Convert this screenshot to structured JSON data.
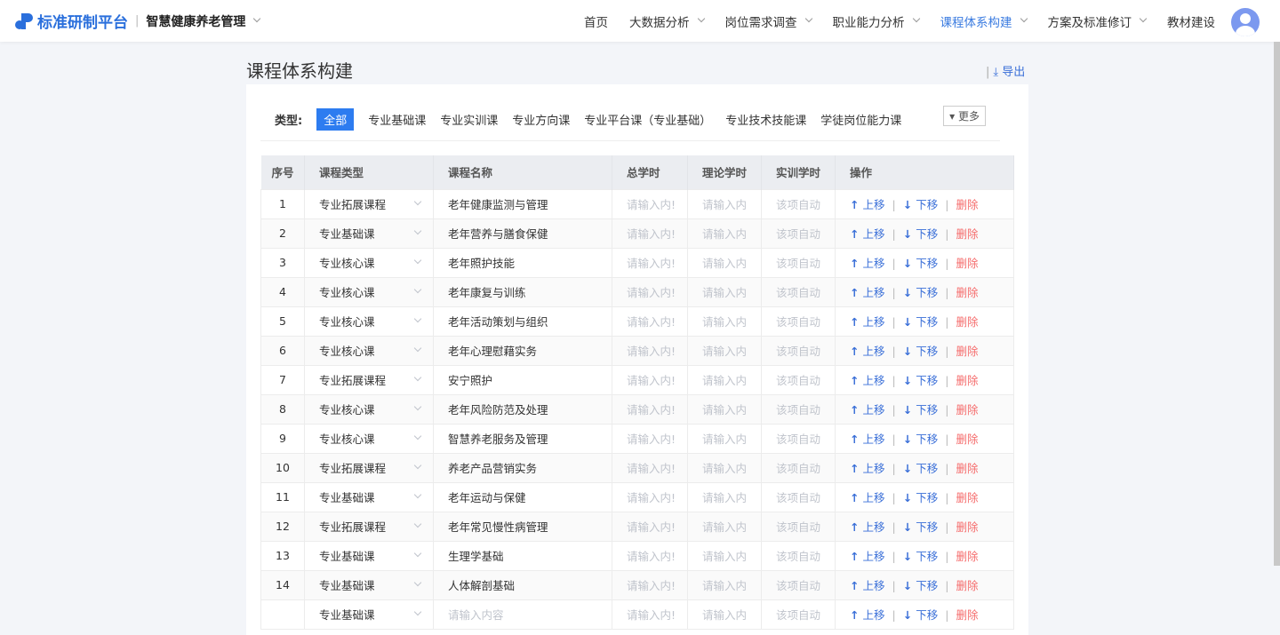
{
  "header": {
    "logo": "标准研制平台",
    "system": "智慧健康养老管理",
    "nav": [
      {
        "label": "首页",
        "dropdown": false
      },
      {
        "label": "大数据分析",
        "dropdown": true
      },
      {
        "label": "岗位需求调查",
        "dropdown": true
      },
      {
        "label": "职业能力分析",
        "dropdown": true
      },
      {
        "label": "课程体系构建",
        "dropdown": true,
        "active": true
      },
      {
        "label": "方案及标准修订",
        "dropdown": true
      },
      {
        "label": "教材建设",
        "dropdown": false
      }
    ]
  },
  "page": {
    "title": "课程体系构建",
    "export": "导出"
  },
  "filter": {
    "label": "类型:",
    "items": [
      "全部",
      "专业基础课",
      "专业实训课",
      "专业方向课",
      "专业平台课（专业基础）",
      "专业技术技能课",
      "学徒岗位能力课"
    ],
    "active": 0,
    "more": "更多"
  },
  "table": {
    "headers": [
      "序号",
      "课程类型",
      "课程名称",
      "总学时",
      "理论学时",
      "实训学时",
      "操作"
    ],
    "placeholders": {
      "total": "请输入内!",
      "theory": "请输入内",
      "practice": "该项自动",
      "name": "请输入内容"
    },
    "actions": {
      "up": "上移",
      "down": "下移",
      "delete": "删除"
    },
    "rows": [
      {
        "no": "1",
        "type": "专业拓展课程",
        "name": "老年健康监测与管理"
      },
      {
        "no": "2",
        "type": "专业基础课",
        "name": "老年营养与膳食保健"
      },
      {
        "no": "3",
        "type": "专业核心课",
        "name": "老年照护技能"
      },
      {
        "no": "4",
        "type": "专业核心课",
        "name": "老年康复与训练"
      },
      {
        "no": "5",
        "type": "专业核心课",
        "name": "老年活动策划与组织"
      },
      {
        "no": "6",
        "type": "专业核心课",
        "name": "老年心理慰藉实务"
      },
      {
        "no": "7",
        "type": "专业拓展课程",
        "name": "安宁照护"
      },
      {
        "no": "8",
        "type": "专业核心课",
        "name": "老年风险防范及处理"
      },
      {
        "no": "9",
        "type": "专业核心课",
        "name": "智慧养老服务及管理"
      },
      {
        "no": "10",
        "type": "专业拓展课程",
        "name": "养老产品营销实务"
      },
      {
        "no": "11",
        "type": "专业基础课",
        "name": "老年运动与保健"
      },
      {
        "no": "12",
        "type": "专业拓展课程",
        "name": "老年常见慢性病管理"
      },
      {
        "no": "13",
        "type": "专业基础课",
        "name": "生理学基础"
      },
      {
        "no": "14",
        "type": "专业基础课",
        "name": "人体解剖基础"
      },
      {
        "no": "",
        "type": "专业基础课",
        "name": ""
      }
    ]
  }
}
